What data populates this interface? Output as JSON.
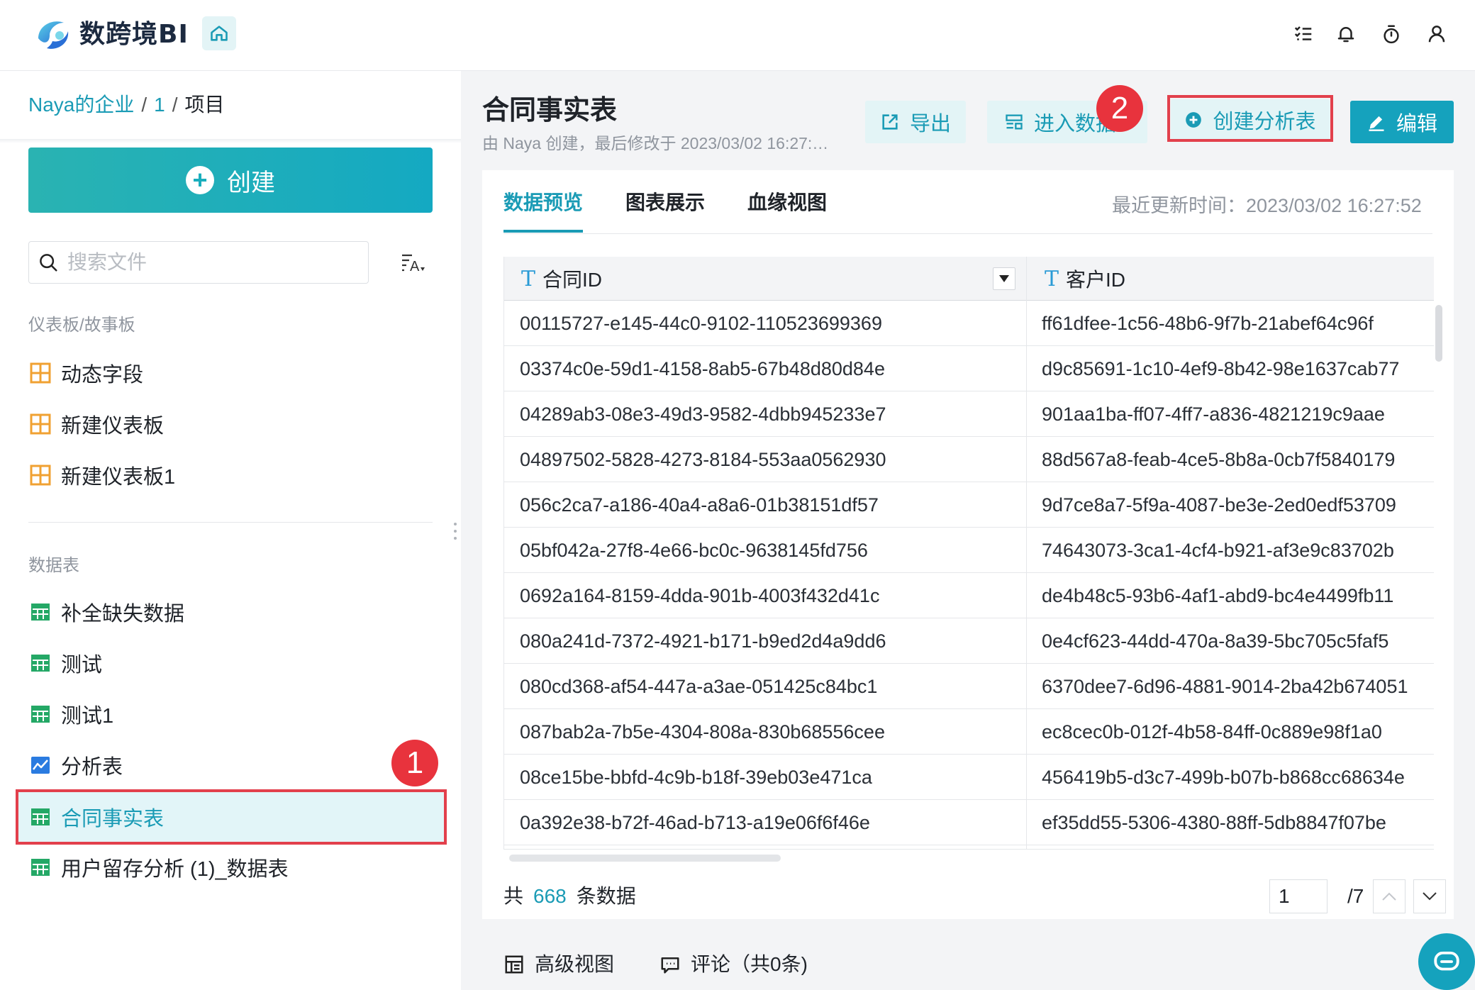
{
  "app": {
    "name": "数跨境BI"
  },
  "breadcrumb": {
    "org": "Naya的企业",
    "sep1": "/",
    "folder": "1",
    "sep2": "/",
    "current": "项目"
  },
  "create_button": {
    "label": "创建"
  },
  "search": {
    "placeholder": "搜索文件"
  },
  "sections": {
    "dashboards": {
      "title": "仪表板/故事板",
      "items": [
        {
          "label": "动态字段"
        },
        {
          "label": "新建仪表板"
        },
        {
          "label": "新建仪表板1"
        }
      ]
    },
    "datasets": {
      "title": "数据表",
      "items": [
        {
          "label": "补全缺失数据"
        },
        {
          "label": "测试"
        },
        {
          "label": "测试1"
        },
        {
          "label": "分析表"
        },
        {
          "label": "合同事实表"
        },
        {
          "label": "用户留存分析 (1)_数据表"
        }
      ]
    }
  },
  "badges": {
    "one": "1",
    "two": "2"
  },
  "page": {
    "title": "合同事实表",
    "subtitle": "由 Naya 创建，最后修改于 2023/03/02 16:27:…",
    "actions": {
      "export": "导出",
      "enter": "进入数据",
      "create_analysis": "创建分析表",
      "edit": "编辑"
    },
    "tabs": [
      {
        "label": "数据预览"
      },
      {
        "label": "图表展示"
      },
      {
        "label": "血缘视图"
      }
    ],
    "update_time": "最近更新时间：2023/03/02 16:27:52"
  },
  "table": {
    "columns": [
      {
        "type": "T",
        "label": "合同ID"
      },
      {
        "type": "T",
        "label": "客户ID"
      }
    ],
    "rows": [
      [
        "00115727-e145-44c0-9102-110523699369",
        "ff61dfee-1c56-48b6-9f7b-21abef64c96f"
      ],
      [
        "03374c0e-59d1-4158-8ab5-67b48d80d84e",
        "d9c85691-1c10-4ef9-8b42-98e1637cab77"
      ],
      [
        "04289ab3-08e3-49d3-9582-4dbb945233e7",
        "901aa1ba-ff07-4ff7-a836-4821219c9aae"
      ],
      [
        "04897502-5828-4273-8184-553aa0562930",
        "88d567a8-feab-4ce5-8b8a-0cb7f5840179"
      ],
      [
        "056c2ca7-a186-40a4-a8a6-01b38151df57",
        "9d7ce8a7-5f9a-4087-be3e-2ed0edf53709"
      ],
      [
        "05bf042a-27f8-4e66-bc0c-9638145fd756",
        "74643073-3ca1-4cf4-b921-af3e9c83702b"
      ],
      [
        "0692a164-8159-4dda-901b-4003f432d41c",
        "de4b48c5-93b6-4af1-abd9-bc4e4499fb11"
      ],
      [
        "080a241d-7372-4921-b171-b9ed2d4a9dd6",
        "0e4cf623-44dd-470a-8a39-5bc705c5faf5"
      ],
      [
        "080cd368-af54-447a-a3ae-051425c84bc1",
        "6370dee7-6d96-4881-9014-2ba42b674051"
      ],
      [
        "087bab2a-7b5e-4304-808a-830b68556cee",
        "ec8cec0b-012f-4b58-84ff-0c889e98f1a0"
      ],
      [
        "08ce15be-bbfd-4c9b-b18f-39eb03e471ca",
        "456419b5-d3c7-499b-b07b-b868cc68634e"
      ],
      [
        "0a392e38-b72f-46ad-b713-a19e06f6f46e",
        "ef35dd55-5306-4380-88ff-5db8847f07be"
      ]
    ]
  },
  "footer": {
    "total_prefix": "共",
    "total_count": "668",
    "total_suffix": "条数据",
    "page_input": "1",
    "page_total": "/7"
  },
  "bottom": {
    "advanced_view": "高级视图",
    "comments": "评论（共0条)"
  },
  "colors": {
    "accent": "#1a9bb5",
    "highlight": "#e2404c",
    "edit_button": "#15a2bd"
  }
}
